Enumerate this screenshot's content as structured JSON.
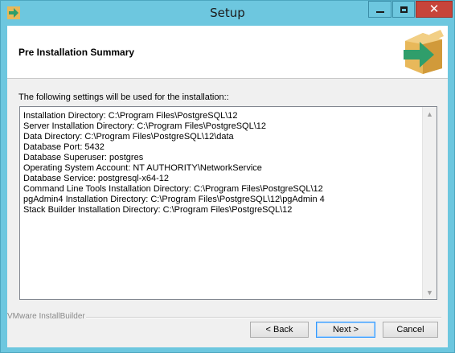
{
  "window": {
    "title": "Setup"
  },
  "header": {
    "title": "Pre Installation Summary"
  },
  "main": {
    "intro": "The following settings will be used for the installation::",
    "summary_lines": [
      "Installation Directory: C:\\Program Files\\PostgreSQL\\12",
      "Server Installation Directory: C:\\Program Files\\PostgreSQL\\12",
      "Data Directory: C:\\Program Files\\PostgreSQL\\12\\data",
      "Database Port: 5432",
      "Database Superuser: postgres",
      "Operating System Account: NT AUTHORITY\\NetworkService",
      "Database Service: postgresql-x64-12",
      "Command Line Tools Installation Directory: C:\\Program Files\\PostgreSQL\\12",
      "pgAdmin4 Installation Directory: C:\\Program Files\\PostgreSQL\\12\\pgAdmin 4",
      "Stack Builder Installation Directory: C:\\Program Files\\PostgreSQL\\12"
    ]
  },
  "footer": {
    "brand": "VMware InstallBuilder",
    "back_label": "< Back",
    "next_label": "Next >",
    "cancel_label": "Cancel"
  },
  "colors": {
    "titlebar": "#6dc7df",
    "close_button": "#c7443a",
    "dialog_bg": "#f0f0f0",
    "box_green": "#2f9e6b",
    "box_tan": "#e8b85a"
  },
  "icons": {
    "app": "arrow-icon",
    "minimize": "minimize-icon",
    "maximize": "maximize-icon",
    "close": "close-icon",
    "header": "package-box-icon",
    "scroll_up": "chevron-up-icon",
    "scroll_down": "chevron-down-icon"
  }
}
